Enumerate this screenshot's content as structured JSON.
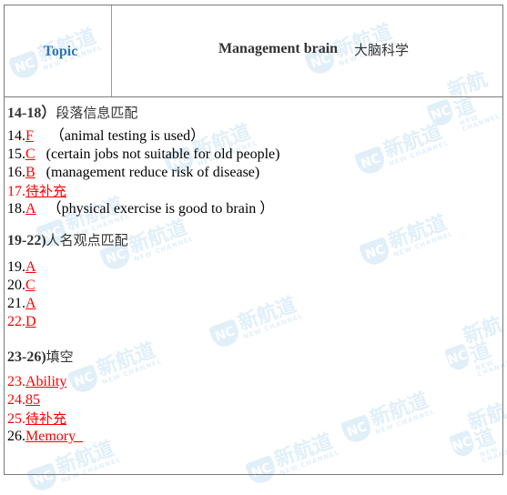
{
  "header": {
    "topic_label": "Topic",
    "title_en": "Management brain",
    "title_cn": "大脑科学"
  },
  "sections": [
    {
      "heading_num": "14-18）",
      "heading_cn": "段落信息匹配",
      "answers": [
        {
          "num": "14.",
          "answer": "F",
          "note": "（animal testing is used）",
          "num_red": false
        },
        {
          "num": "15.",
          "answer": "C",
          "note": "(certain jobs not suitable for old people)",
          "num_red": false
        },
        {
          "num": "16.",
          "answer": "B",
          "note": "(management reduce risk of disease)",
          "num_red": false
        },
        {
          "num": "17.",
          "answer": "待补充",
          "note": "",
          "num_red": true
        },
        {
          "num": "18.",
          "answer": "A",
          "note": "（physical exercise is good to brain ）",
          "num_red": false
        }
      ]
    },
    {
      "heading_num": "19-22)",
      "heading_cn": "人名观点匹配",
      "answers": [
        {
          "num": "19.",
          "answer": "A",
          "note": "",
          "num_red": false
        },
        {
          "num": "20.",
          "answer": "C",
          "note": "",
          "num_red": false
        },
        {
          "num": "21.",
          "answer": "A",
          "note": "",
          "num_red": false
        },
        {
          "num": "22.",
          "answer": "D",
          "note": "",
          "num_red": true
        }
      ]
    },
    {
      "heading_num": "23-26)",
      "heading_cn": "填空",
      "answers": [
        {
          "num": "23.",
          "answer": "Ability",
          "note": "",
          "num_red": true
        },
        {
          "num": "24.",
          "answer": "85",
          "note": "",
          "num_red": true
        },
        {
          "num": "25.",
          "answer": "待补充",
          "note": "",
          "num_red": true
        },
        {
          "num": "26.",
          "answer": "Memory  ",
          "note": "",
          "num_red": false
        }
      ]
    }
  ],
  "watermark": {
    "logo": "NC",
    "cn": "新航道",
    "en": "NEW CHANNEL"
  },
  "colors": {
    "topic": "#2e74b5",
    "answer": "#ff0000",
    "heading": "#333333",
    "border": "#7a7a7a"
  }
}
